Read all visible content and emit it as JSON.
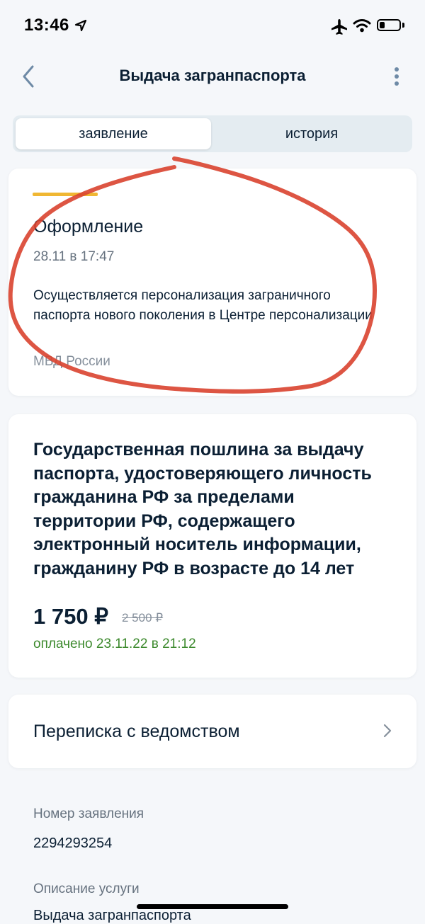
{
  "status_bar": {
    "time": "13:46"
  },
  "header": {
    "title": "Выдача загранпаспорта"
  },
  "tabs": [
    {
      "label": "заявление"
    },
    {
      "label": "история"
    }
  ],
  "status_card": {
    "title": "Оформление",
    "date": "28.11 в 17:47",
    "description": "Осуществляется персонализация заграничного паспорта нового поколения в Центре персонализации",
    "organization": "МВД России",
    "accent_color": "#f0b733"
  },
  "fee_card": {
    "title": "Государственная пошлина за выдачу паспорта, удостоверяющего личность гражданина РФ за пределами территории РФ, содержащего электронный носитель информации, гражданину РФ в возрасте до 14 лет",
    "price": "1 750 ₽",
    "old_price": "2 500 ₽",
    "paid_status": "оплачено 23.11.22 в 21:12",
    "paid_color": "#3d8a2e"
  },
  "correspondence": {
    "title": "Переписка с ведомством"
  },
  "application_info": {
    "number_label": "Номер заявления",
    "number_value": "2294293254",
    "service_label": "Описание услуги",
    "service_value": "Выдача загранпаспорта"
  },
  "annotation_color": "#d9432f",
  "icons": [
    "location-arrow-icon",
    "airplane-icon",
    "wifi-icon",
    "battery-icon",
    "back-chevron-icon",
    "more-vertical-icon",
    "chevron-right-icon"
  ]
}
